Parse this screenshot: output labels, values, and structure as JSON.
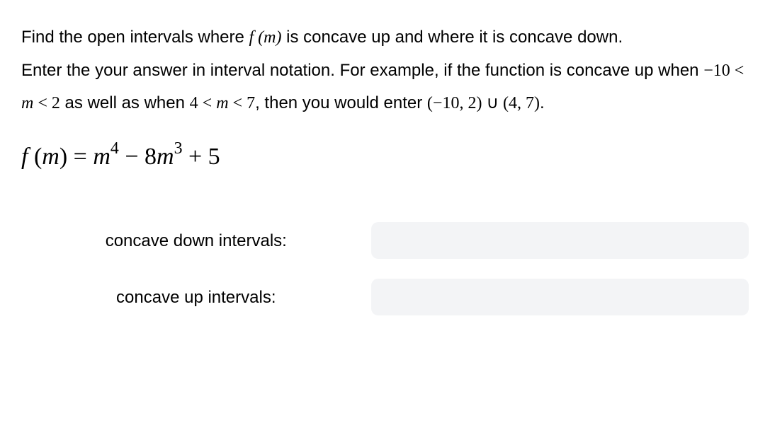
{
  "question": {
    "line1_pre": "Find the open intervals where ",
    "line1_fn": "f (m)",
    "line1_post": " is concave up and where it is concave down.",
    "line2_pre": "Enter the your answer in interval notation. For example, if the function is concave up when ",
    "cond1": "−10 < m < 2",
    "line2_mid": " as well as when ",
    "cond2": "4 < m < 7",
    "line2_post": ", then you would enter ",
    "interval_example": "(−10, 2) ∪ (4, 7)",
    "period": "."
  },
  "formula": {
    "lhs_f": "f ",
    "lhs_var": "(m)",
    "eq": " = ",
    "term1_var": "m",
    "term1_exp": "4",
    "minus": " − ",
    "term2_coef": "8",
    "term2_var": "m",
    "term2_exp": "3",
    "plus_const": " + 5"
  },
  "answers": {
    "down_label": "concave down intervals:",
    "up_label": "concave up intervals:",
    "down_value": "",
    "up_value": "",
    "placeholder": ""
  },
  "chart_data": {
    "type": "table",
    "function": "f(m) = m^4 - 8m^3 + 5",
    "prompts": [
      "concave down intervals",
      "concave up intervals"
    ]
  }
}
